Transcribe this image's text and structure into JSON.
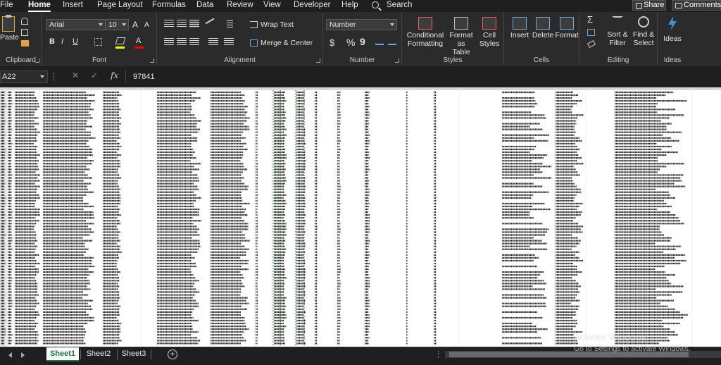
{
  "menu": {
    "tabs": [
      "File",
      "Home",
      "Insert",
      "Page Layout",
      "Formulas",
      "Data",
      "Review",
      "View",
      "Developer",
      "Help"
    ],
    "active_tab": "Home",
    "search_label": "Search",
    "share_label": "Share",
    "comments_label": "Comments"
  },
  "ribbon": {
    "clipboard": {
      "label": "Clipboard",
      "paste": "Paste"
    },
    "font": {
      "label": "Font",
      "font_name": "Arial",
      "font_size": "10",
      "bold": "B",
      "italic": "I",
      "underline": "U",
      "grow": "A",
      "shrink": "A"
    },
    "alignment": {
      "label": "Alignment",
      "wrap_text": "Wrap Text",
      "merge_center": "Merge & Center"
    },
    "number": {
      "label": "Number",
      "format": "Number",
      "currency": "$",
      "percent": "%",
      "comma": "9"
    },
    "styles": {
      "label": "Styles",
      "conditional_formatting": [
        "Conditional",
        "Formatting"
      ],
      "format_as_table": [
        "Format as",
        "Table"
      ],
      "cell_styles": [
        "Cell",
        "Styles"
      ]
    },
    "cells": {
      "label": "Cells",
      "insert": "Insert",
      "delete": "Delete",
      "format": "Format"
    },
    "editing": {
      "label": "Editing",
      "sort_filter": [
        "Sort &",
        "Filter"
      ],
      "find_select": [
        "Find &",
        "Select"
      ]
    },
    "ideas": {
      "label": "Ideas",
      "button": "Ideas"
    }
  },
  "formula_bar": {
    "name_box": "A22",
    "fx": "fx",
    "value": "97841"
  },
  "sheets": {
    "tabs": [
      "Sheet1",
      "Sheet2",
      "Sheet3"
    ],
    "active": "Sheet1"
  },
  "watermark": {
    "line1": "Activate Windows",
    "line2": "Go to Settings to activate Windows."
  },
  "colors": {
    "background": "#1f1f1f",
    "ribbon": "#2b2b2b",
    "grid": "#ffffff",
    "accent_green": "#217346",
    "selection_dash": "#2e8b3a"
  },
  "icons": {
    "search": "search-icon",
    "share": "share-icon",
    "comments": "comment-icon",
    "paste": "clipboard-icon",
    "ideas": "lightbulb-icon",
    "add_sheet": "plus-circle-icon"
  }
}
